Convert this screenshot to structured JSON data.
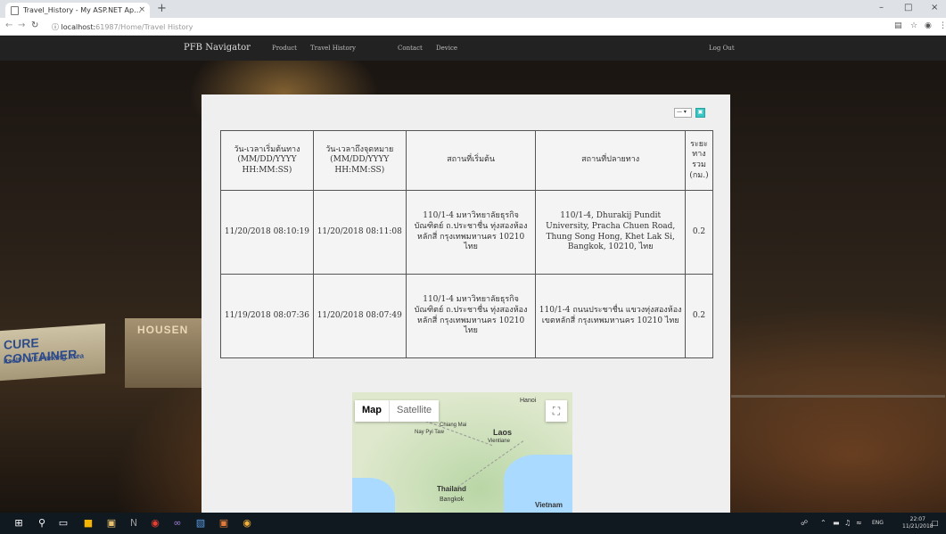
{
  "browser": {
    "tab_title": "Travel_History - My ASP.NET Ap…",
    "tab_close": "×",
    "new_tab": "+",
    "url_host": "localhost:",
    "url_rest": "61987/Home/Travel History",
    "window_min": "–",
    "window_max": "□",
    "window_close": "×"
  },
  "navbar": {
    "brand": "PFB Navigator",
    "links": [
      "Product",
      "Travel History",
      "Contact",
      "Device"
    ],
    "logout": "Log Out"
  },
  "background_signs": {
    "container_text": "CURE CONTAINER",
    "container_sub": "itself • WE Parking Area",
    "building_text": "HOUSEN"
  },
  "controls": {
    "select_value": "—",
    "select_arrow": "▾",
    "go_button": "▣"
  },
  "table": {
    "headers": [
      "วัน-เวลาเริ่มต้นทาง (MM/DD/YYYY HH:MM:SS)",
      "วัน-เวลาถึงจุดหมาย (MM/DD/YYYY HH:MM:SS)",
      "สถานที่เริ่มต้น",
      "สถานที่ปลายทาง",
      "ระยะทางรวม (กม.)"
    ],
    "rows": [
      {
        "start_time": "11/20/2018 08:10:19",
        "end_time": "11/20/2018 08:11:08",
        "start_place": "110/1-4 มหาวิทยาลัยธุรกิจบัณฑิตย์ ถ.ประชาชื่น ทุ่งสองห้อง หลักสี่ กรุงเทพมหานคร 10210 ไทย",
        "end_place": "110/1-4, Dhurakij Pundit University, Pracha Chuen Road, Thung Song Hong, Khet Lak Si, Bangkok, 10210, ไทย",
        "distance": "0.2"
      },
      {
        "start_time": "11/19/2018 08:07:36",
        "end_time": "11/20/2018 08:07:49",
        "start_place": "110/1-4 มหาวิทยาลัยธุรกิจบัณฑิตย์ ถ.ประชาชื่น ทุ่งสองห้อง หลักสี่ กรุงเทพมหานคร 10210 ไทย",
        "end_place": "110/1-4 ถนนประชาชื่น แขวงทุ่งสองห้อง เขตหลักสี่ กรุงเทพมหานคร 10210 ไทย",
        "distance": "0.2"
      }
    ]
  },
  "map": {
    "map_button": "Map",
    "satellite_button": "Satellite",
    "fullscreen_icon": "⛶",
    "labels": {
      "hanoi": "Hanoi",
      "laos": "Laos",
      "vientiane": "Vientiane",
      "thailand": "Thailand",
      "bangkok": "Bangkok",
      "vietnam": "Vietnam",
      "naypyitaw": "Nay Pyi Taw",
      "chiangmai": "Chiang Mai"
    }
  },
  "taskbar": {
    "time": "22:07",
    "date": "11/21/2018",
    "lang": "ENG"
  }
}
